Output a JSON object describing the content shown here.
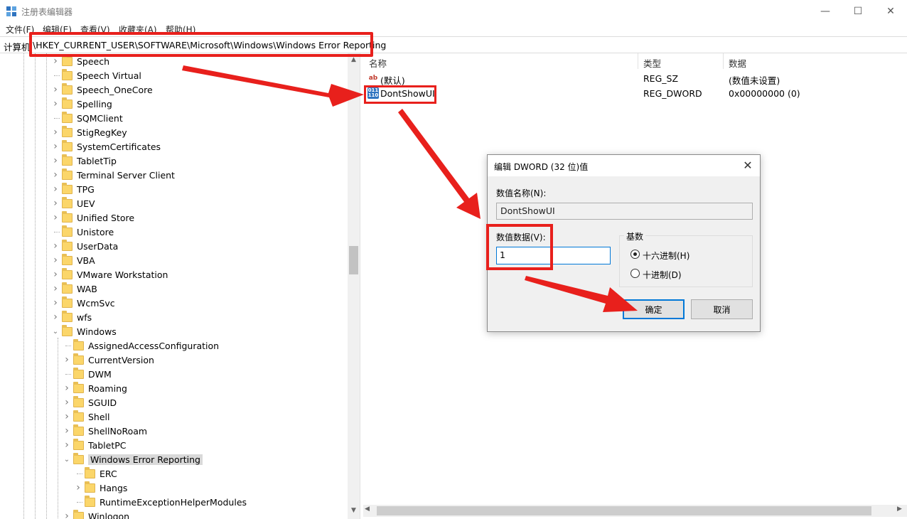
{
  "window": {
    "title": "注册表编辑器",
    "minimize_glyph": "—",
    "maximize_glyph": "☐",
    "close_glyph": "✕",
    "icon": "regedit-icon"
  },
  "menu": [
    "文件(F)",
    "编辑(E)",
    "查看(V)",
    "收藏夹(A)",
    "帮助(H)"
  ],
  "address": {
    "prefix": "计算机",
    "path": "\\HKEY_CURRENT_USER\\SOFTWARE\\Microsoft\\Windows\\Windows Error Reporting"
  },
  "tree": {
    "items": [
      {
        "label": "Speech",
        "level": 1,
        "expander": "collapsed"
      },
      {
        "label": "Speech Virtual",
        "level": 1,
        "expander": "none"
      },
      {
        "label": "Speech_OneCore",
        "level": 1,
        "expander": "collapsed"
      },
      {
        "label": "Spelling",
        "level": 1,
        "expander": "collapsed"
      },
      {
        "label": "SQMClient",
        "level": 1,
        "expander": "none"
      },
      {
        "label": "StigRegKey",
        "level": 1,
        "expander": "collapsed"
      },
      {
        "label": "SystemCertificates",
        "level": 1,
        "expander": "collapsed"
      },
      {
        "label": "TabletTip",
        "level": 1,
        "expander": "collapsed"
      },
      {
        "label": "Terminal Server Client",
        "level": 1,
        "expander": "collapsed"
      },
      {
        "label": "TPG",
        "level": 1,
        "expander": "collapsed"
      },
      {
        "label": "UEV",
        "level": 1,
        "expander": "collapsed"
      },
      {
        "label": "Unified Store",
        "level": 1,
        "expander": "collapsed"
      },
      {
        "label": "Unistore",
        "level": 1,
        "expander": "none"
      },
      {
        "label": "UserData",
        "level": 1,
        "expander": "collapsed"
      },
      {
        "label": "VBA",
        "level": 1,
        "expander": "collapsed"
      },
      {
        "label": "VMware Workstation",
        "level": 1,
        "expander": "collapsed"
      },
      {
        "label": "WAB",
        "level": 1,
        "expander": "collapsed"
      },
      {
        "label": "WcmSvc",
        "level": 1,
        "expander": "collapsed"
      },
      {
        "label": "wfs",
        "level": 1,
        "expander": "collapsed"
      },
      {
        "label": "Windows",
        "level": 1,
        "expander": "expanded"
      },
      {
        "label": "AssignedAccessConfiguration",
        "level": 2,
        "expander": "none"
      },
      {
        "label": "CurrentVersion",
        "level": 2,
        "expander": "collapsed"
      },
      {
        "label": "DWM",
        "level": 2,
        "expander": "none"
      },
      {
        "label": "Roaming",
        "level": 2,
        "expander": "collapsed"
      },
      {
        "label": "SGUID",
        "level": 2,
        "expander": "collapsed"
      },
      {
        "label": "Shell",
        "level": 2,
        "expander": "collapsed"
      },
      {
        "label": "ShellNoRoam",
        "level": 2,
        "expander": "collapsed"
      },
      {
        "label": "TabletPC",
        "level": 2,
        "expander": "collapsed"
      },
      {
        "label": "Windows Error Reporting",
        "level": 2,
        "expander": "expanded",
        "selected": true
      },
      {
        "label": "ERC",
        "level": 3,
        "expander": "none"
      },
      {
        "label": "Hangs",
        "level": 3,
        "expander": "collapsed"
      },
      {
        "label": "RuntimeExceptionHelperModules",
        "level": 3,
        "expander": "none"
      },
      {
        "label": "Winlogon",
        "level": 2,
        "expander": "collapsed"
      }
    ]
  },
  "values_pane": {
    "columns": {
      "name": "名称",
      "type": "类型",
      "data": "数据"
    },
    "rows": [
      {
        "icon": "string-value-icon",
        "icon_glyph": "ab",
        "name": "(默认)",
        "type": "REG_SZ",
        "data": "(数值未设置)"
      },
      {
        "icon": "binary-value-icon",
        "icon_glyph": "011\n110",
        "name": "DontShowUI",
        "type": "REG_DWORD",
        "data": "0x00000000 (0)"
      }
    ]
  },
  "dialog": {
    "title": "编辑 DWORD (32 位)值",
    "close_glyph": "✕",
    "name_label": "数值名称(N):",
    "name_value": "DontShowUI",
    "data_label": "数值数据(V):",
    "data_value": "1",
    "base_label": "基数",
    "radio_hex": "十六进制(H)",
    "radio_dec": "十进制(D)",
    "selected_base": "hex",
    "ok": "确定",
    "cancel": "取消"
  },
  "annotation_color": "#e8201c"
}
